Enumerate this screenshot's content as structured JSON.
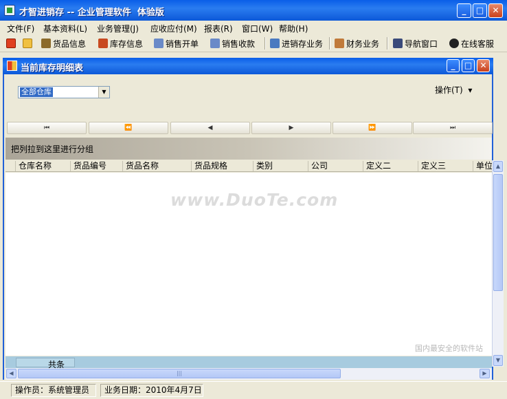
{
  "window": {
    "title": "才智进销存 -- 企业管理软件  体验版",
    "min_glyph": "_",
    "max_glyph": "□",
    "close_glyph": "✕"
  },
  "menu": [
    "文件(F)",
    "基本资料(L)",
    "业务管理(J)",
    "应收应付(M)",
    "报表(R)",
    "窗口(W)",
    "帮助(H)"
  ],
  "toolbar": {
    "items": [
      {
        "label": "货品信息",
        "icon": "goods-icon",
        "color": "#8b6a2a"
      },
      {
        "label": "库存信息",
        "icon": "house-icon",
        "color": "#c84a20"
      },
      {
        "label": "销售开单",
        "icon": "sales-order-icon",
        "color": "#6a8ac8"
      },
      {
        "label": "销售收款",
        "icon": "sales-receipt-icon",
        "color": "#6a8ac8"
      },
      {
        "label": "进销存业务",
        "icon": "inventory-business-icon",
        "color": "#4a7ac0"
      },
      {
        "label": "财务业务",
        "icon": "finance-icon",
        "color": "#c07a3a"
      },
      {
        "label": "导航窗口",
        "icon": "navigation-icon",
        "color": "#3a4a7a"
      },
      {
        "label": "在线客服",
        "icon": "qq-penguin-icon",
        "color": "#222222"
      }
    ]
  },
  "child_window": {
    "title": "当前库存明细表",
    "warehouse_select": "全部仓库",
    "operation_menu": "操作(T)  ▾",
    "nav": [
      "⏮",
      "⏪",
      "◀",
      "▶",
      "⏩",
      "⏭"
    ],
    "group_hint": "把列拉到这里进行分组",
    "columns": [
      "仓库名称",
      "货品编号",
      "货品名称",
      "货品规格",
      "类别",
      "公司",
      "定义二",
      "定义三",
      "单位"
    ],
    "footer_total": "共条"
  },
  "watermark": "www.DuoTe.com",
  "status": {
    "operator": "操作员：系统管理员",
    "business_date": "业务日期：2010年4月7日"
  },
  "corner_watermark": "国内最安全的软件站"
}
